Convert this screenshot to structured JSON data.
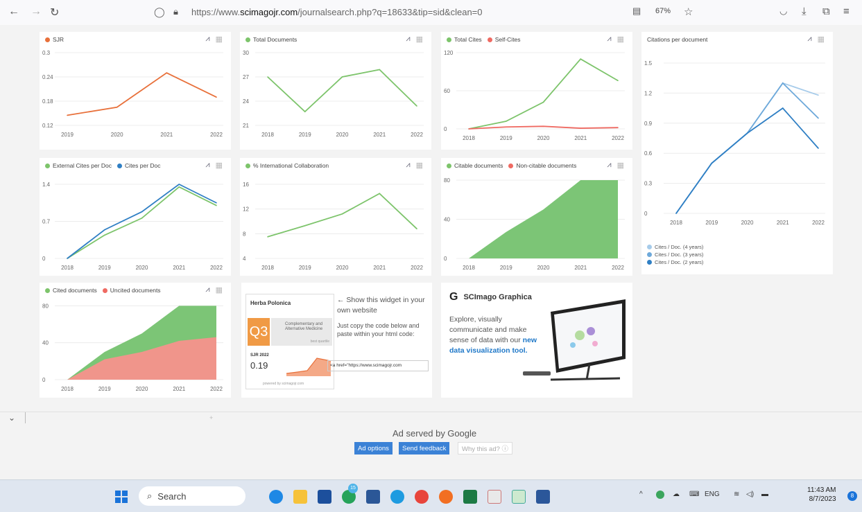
{
  "browser": {
    "url_prefix": "https://www.",
    "url_host": "scimagojr.com",
    "url_path": "/journalsearch.php?q=18633&tip=sid&clean=0",
    "zoom": "67%"
  },
  "colors": {
    "orange": "#e8703a",
    "green": "#7dc46b",
    "red": "#ef6a62",
    "blue": "#2f7fc4",
    "lightblue": "#a6cbea",
    "midblue": "#6ea9da",
    "area_green": "#7cc576",
    "area_red": "#f0958b"
  },
  "chart_data": [
    {
      "type": "line",
      "legend": [
        "SJR"
      ],
      "x": [
        "2019",
        "2020",
        "2021",
        "2022"
      ],
      "series": [
        {
          "name": "SJR",
          "values": [
            0.145,
            0.165,
            0.25,
            0.19
          ]
        }
      ],
      "yticks": [
        "0.12",
        "0.18",
        "0.24",
        "0.3"
      ],
      "ylim": [
        0.12,
        0.3
      ]
    },
    {
      "type": "line",
      "legend": [
        "Total Documents"
      ],
      "x": [
        "2018",
        "2019",
        "2020",
        "2021",
        "2022"
      ],
      "series": [
        {
          "name": "Total Documents",
          "values": [
            27,
            22.7,
            27,
            27.9,
            23.4
          ]
        }
      ],
      "yticks": [
        "21",
        "24",
        "27",
        "30"
      ],
      "ylim": [
        21,
        30
      ]
    },
    {
      "type": "line",
      "legend": [
        "Total Cites",
        "Self-Cites"
      ],
      "x": [
        "2018",
        "2019",
        "2020",
        "2021",
        "2022"
      ],
      "series": [
        {
          "name": "Total Cites",
          "values": [
            0,
            12,
            42,
            110,
            76
          ]
        },
        {
          "name": "Self-Cites",
          "values": [
            0,
            3,
            4,
            1,
            2
          ]
        }
      ],
      "yticks": [
        "0",
        "60",
        "120"
      ],
      "ylim": [
        0,
        120
      ]
    },
    {
      "type": "line",
      "title": "Citations per document",
      "x": [
        "2018",
        "2019",
        "2020",
        "2021",
        "2022"
      ],
      "series": [
        {
          "name": "Cites / Doc. (4 years)",
          "values": [
            0,
            0.5,
            0.8,
            1.3,
            1.18
          ]
        },
        {
          "name": "Cites / Doc. (3 years)",
          "values": [
            0,
            0.5,
            0.8,
            1.3,
            0.95
          ]
        },
        {
          "name": "Cites / Doc. (2 years)",
          "values": [
            0,
            0.5,
            0.8,
            1.05,
            0.65
          ]
        }
      ],
      "yticks": [
        "0",
        "0.3",
        "0.6",
        "0.9",
        "1.2",
        "1.5"
      ],
      "ylim": [
        0,
        1.5
      ]
    },
    {
      "type": "line",
      "legend": [
        "External Cites per Doc",
        "Cites per Doc"
      ],
      "x": [
        "2018",
        "2019",
        "2020",
        "2021",
        "2022"
      ],
      "series": [
        {
          "name": "External Cites per Doc",
          "values": [
            0,
            0.44,
            0.76,
            1.35,
            1.0
          ]
        },
        {
          "name": "Cites per Doc",
          "values": [
            0,
            0.54,
            0.88,
            1.4,
            1.05
          ]
        }
      ],
      "yticks": [
        "0",
        "0.7",
        "1.4"
      ],
      "ylim": [
        0,
        1.4
      ]
    },
    {
      "type": "line",
      "legend": [
        "% International Collaboration"
      ],
      "x": [
        "2018",
        "2019",
        "2020",
        "2021",
        "2022"
      ],
      "series": [
        {
          "name": "% International Collaboration",
          "values": [
            7.5,
            9.3,
            11.2,
            14.5,
            8.8
          ]
        }
      ],
      "yticks": [
        "4",
        "8",
        "12",
        "16"
      ],
      "ylim": [
        4,
        16
      ]
    },
    {
      "type": "area",
      "legend": [
        "Citable documents",
        "Non-citable documents"
      ],
      "x": [
        "2018",
        "2019",
        "2020",
        "2021",
        "2022"
      ],
      "series": [
        {
          "name": "Citable documents",
          "values": [
            0,
            27,
            50,
            80,
            80
          ]
        },
        {
          "name": "Non-citable documents",
          "values": [
            0,
            0,
            0,
            0,
            0
          ]
        }
      ],
      "yticks": [
        "0",
        "40",
        "80"
      ],
      "ylim": [
        0,
        80
      ]
    },
    {
      "type": "area",
      "legend": [
        "Cited documents",
        "Uncited documents"
      ],
      "x": [
        "2018",
        "2019",
        "2020",
        "2021",
        "2022"
      ],
      "series": [
        {
          "name": "Cited documents",
          "values": [
            0,
            30,
            50,
            80,
            80
          ]
        },
        {
          "name": "Uncited documents",
          "values": [
            0,
            22,
            30,
            42,
            46
          ]
        }
      ],
      "yticks": [
        "0",
        "40",
        "80"
      ],
      "ylim": [
        0,
        90
      ]
    }
  ],
  "widget": {
    "journal": "Herba Polonica",
    "quartile": "Q3",
    "category": "Complementary and Alternative Medicine",
    "quartile_note": "best quartile",
    "sjr_label": "SJR 2022",
    "sjr_value": "0.19",
    "powered": "powered by scimagojr.com",
    "lead": "← Show this widget in your own website",
    "instructions": "Just copy the code below and paste within your html code:",
    "code": "<a href=\"https://www.scimagojr.com"
  },
  "graphica": {
    "title": "SCImago Graphica",
    "text": "Explore, visually communicate and make sense of data with our",
    "link": "new data visualization tool."
  },
  "ad": {
    "served_by": "Ad served by",
    "google": "Google",
    "options": "Ad options",
    "feedback": "Send feedback",
    "why": "Why this ad? ⓘ"
  },
  "taskbar": {
    "search": "Search",
    "lang": "ENG",
    "time": "11:43 AM",
    "date": "8/7/2023",
    "notif_badge": "15"
  }
}
